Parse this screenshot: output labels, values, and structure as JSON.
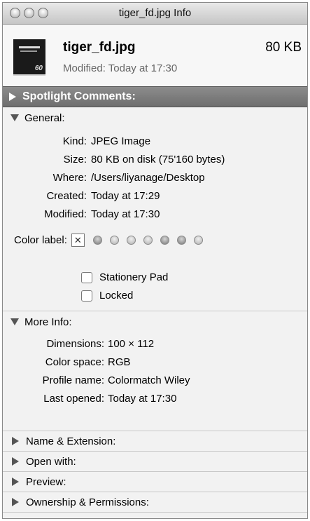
{
  "window": {
    "title": "tiger_fd.jpg Info"
  },
  "file": {
    "name": "tiger_fd.jpg",
    "size": "80 KB",
    "modified": "Modified: Today at 17:30",
    "thumb_number": "60"
  },
  "spotlight": {
    "label": "Spotlight Comments:"
  },
  "general": {
    "label": "General:",
    "rows": [
      {
        "key": "Kind:",
        "value": "JPEG Image"
      },
      {
        "key": "Size:",
        "value": "80 KB on disk (75'160 bytes)"
      },
      {
        "key": "Where:",
        "value": "/Users/liyanage/Desktop"
      },
      {
        "key": "Created:",
        "value": "Today at 17:29"
      },
      {
        "key": "Modified:",
        "value": "Today at 17:30"
      }
    ],
    "color_label": "Color label:",
    "no_color_glyph": "✕",
    "stationery_label": "Stationery Pad",
    "locked_label": "Locked"
  },
  "more_info": {
    "label": "More Info:",
    "rows": [
      {
        "key": "Dimensions:",
        "value": "100 × 112"
      },
      {
        "key": "Color space:",
        "value": "RGB"
      },
      {
        "key": "Profile name:",
        "value": "Colormatch Wiley"
      },
      {
        "key": "Last opened:",
        "value": "Today at 17:30"
      }
    ]
  },
  "collapsed_sections": [
    {
      "label": "Name & Extension:"
    },
    {
      "label": "Open with:"
    },
    {
      "label": "Preview:"
    },
    {
      "label": "Ownership & Permissions:"
    }
  ]
}
